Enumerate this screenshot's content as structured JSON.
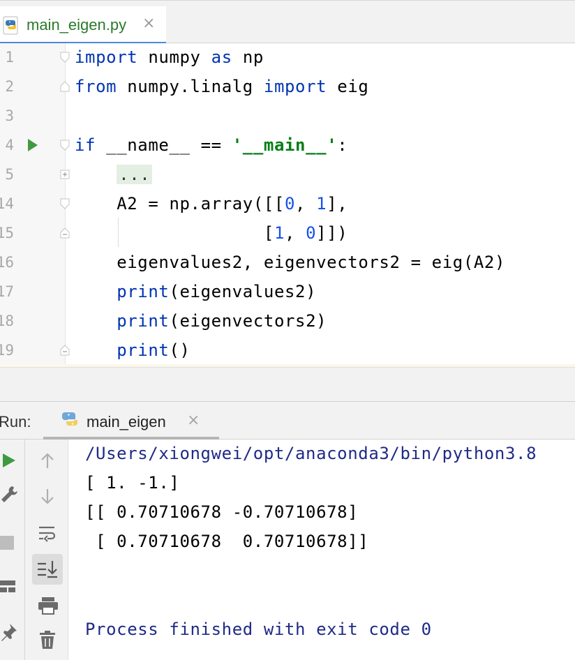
{
  "editor_tab": {
    "filename": "main_eigen.py",
    "close_glyph": "×",
    "icon": "python-file-icon"
  },
  "code_lines": [
    {
      "num": "1",
      "fold": "open-start"
    },
    {
      "num": "2",
      "fold": "open-end"
    },
    {
      "num": "3",
      "fold": ""
    },
    {
      "num": "4",
      "fold": "open-start",
      "run": true
    },
    {
      "num": "5",
      "fold": "collapsed"
    },
    {
      "num": "14",
      "fold": "open-start"
    },
    {
      "num": "15",
      "fold": "open-end"
    },
    {
      "num": "16",
      "fold": ""
    },
    {
      "num": "17",
      "fold": ""
    },
    {
      "num": "18",
      "fold": ""
    },
    {
      "num": "19",
      "fold": "open-end"
    }
  ],
  "code": {
    "l1": {
      "kw1": "import",
      "t1": " numpy ",
      "kw2": "as",
      "t2": " np"
    },
    "l2": {
      "kw1": "from",
      "t1": " numpy.linalg ",
      "kw2": "import",
      "t2": " eig"
    },
    "l4": {
      "kw1": "if",
      "t1": " __name__ == ",
      "str": "'__main__'",
      "t2": ":"
    },
    "l5": {
      "indent": "    ",
      "chip": "..."
    },
    "l14": {
      "t1": "    A2 = np.array([[",
      "n1": "0",
      "t2": ", ",
      "n2": "1",
      "t3": "],"
    },
    "l15": {
      "t1": "                  [",
      "n1": "1",
      "t2": ", ",
      "n2": "0",
      "t3": "]])"
    },
    "l16": {
      "t1": "    eigenvalues2, eigenvectors2 = eig(A2)"
    },
    "l17": {
      "indent": "    ",
      "kw": "print",
      "t1": "(eigenvalues2)"
    },
    "l18": {
      "indent": "    ",
      "kw": "print",
      "t1": "(eigenvectors2)"
    },
    "l19": {
      "indent": "    ",
      "kw": "print",
      "t1": "()"
    }
  },
  "run_panel": {
    "label": "Run:",
    "tab_label": "main_eigen",
    "close_glyph": "×",
    "left_tools": [
      "rerun-icon",
      "wrench-icon",
      "stop-icon",
      "layout-icon",
      "pin-icon"
    ],
    "right_tools": [
      "up-arrow-icon",
      "down-arrow-icon",
      "soft-wrap-icon",
      "scroll-to-end-icon",
      "print-icon",
      "trash-icon"
    ]
  },
  "console": {
    "line1": "/Users/xiongwei/opt/anaconda3/bin/python3.8",
    "line2": "[ 1. -1.]",
    "line3": "[[ 0.70710678 -0.70710678]",
    "line4": " [ 0.70710678  0.70710678]]",
    "line5": "Process finished with exit code 0"
  },
  "colors": {
    "keyword": "#0033b3",
    "string": "#067d17",
    "number": "#1750eb",
    "console_blue": "#1f2a87",
    "run_green": "#3e9a3e",
    "tab_accent": "#4a89dc"
  }
}
